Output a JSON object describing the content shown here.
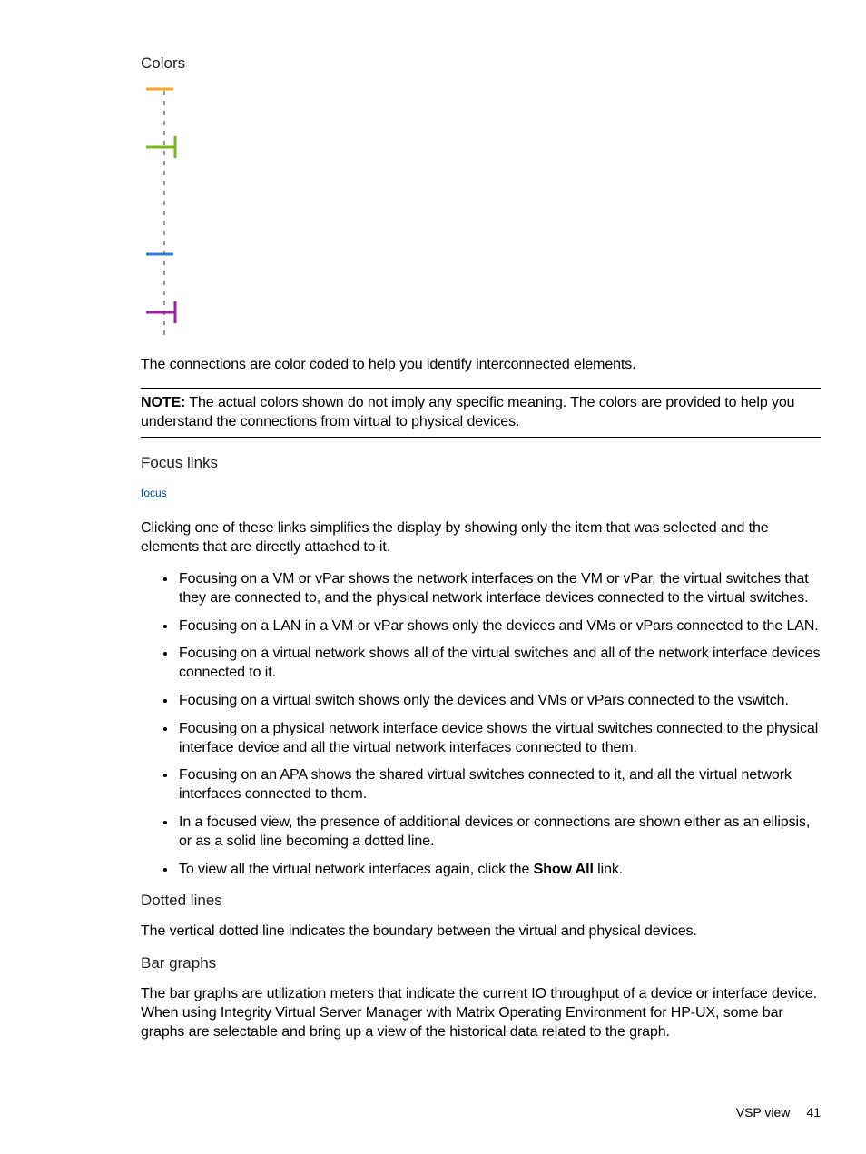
{
  "headings": {
    "colors": "Colors",
    "focus_links": "Focus links",
    "dotted_lines": "Dotted lines",
    "bar_graphs": "Bar graphs"
  },
  "colors_paragraph": "The connections are color coded to help you identify interconnected elements.",
  "note": {
    "label": "NOTE:",
    "text": " The actual colors shown do not imply any specific meaning. The colors are provided to help you understand the connections from virtual to physical devices."
  },
  "focus_link_text": "focus",
  "focus_intro": "Clicking one of these links simplifies the display by showing only the item that was selected and the elements that are directly attached to it.",
  "focus_bullets": [
    "Focusing on a VM or vPar shows the network interfaces on the VM or vPar, the virtual switches that they are connected to, and the physical network interface devices connected to the virtual switches.",
    "Focusing on a LAN in a VM or vPar shows only the devices and VMs or vPars connected to the LAN.",
    "Focusing on a virtual network shows all of the virtual switches and all of the network interface devices connected to it.",
    "Focusing on a virtual switch shows only the devices and VMs or vPars connected to the vswitch.",
    "Focusing on a physical network interface device shows the virtual switches connected to the physical interface device and all the virtual network interfaces connected to them.",
    "Focusing on an APA shows the shared virtual switches connected to it, and all the virtual network interfaces connected to them.",
    "In a focused view, the presence of additional devices or connections are shown either as an ellipsis, or as a solid line becoming a dotted line."
  ],
  "focus_last_bullet": {
    "prefix": "To view all the virtual network interfaces again, click the ",
    "bold": "Show All",
    "suffix": " link."
  },
  "dotted_lines_text": "The vertical dotted line indicates the boundary between the virtual and physical devices.",
  "bar_graphs_text": "The bar graphs are utilization meters that indicate the current IO throughput of a device or interface device. When using Integrity Virtual Server Manager with Matrix Operating Environment for HP-UX, some bar graphs are selectable and bring up a view of the historical data related to the graph.",
  "footer": {
    "label": "VSP view",
    "page": "41"
  },
  "diagram_colors": {
    "orange": "#f5a623",
    "green": "#7cb518",
    "blue": "#2e7cd6",
    "purple": "#a020a0",
    "dash": "#999"
  }
}
